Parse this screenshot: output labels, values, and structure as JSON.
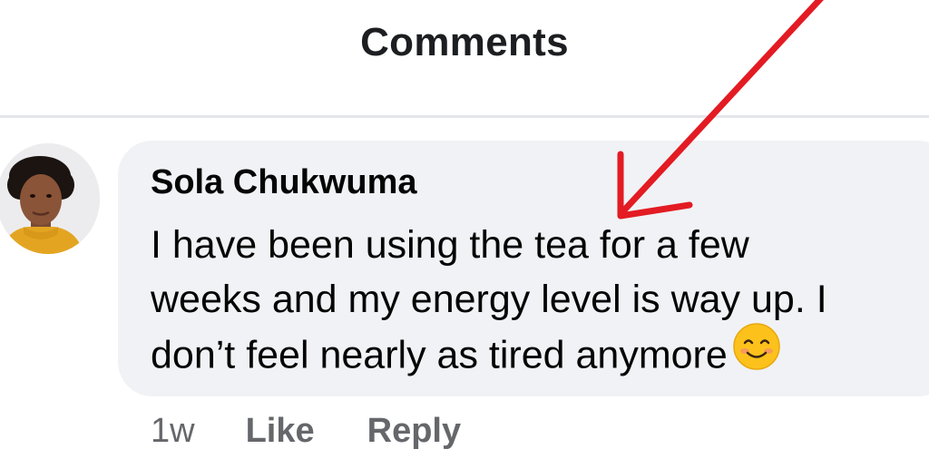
{
  "header": {
    "title": "Comments"
  },
  "comment": {
    "author": "Sola Chukwuma",
    "text_line_1": "I have been using the tea for a few",
    "text_line_2": "weeks and my energy level is way up. I",
    "text_line_3": "don’t feel nearly as tired anymore",
    "emoji": "smiling-face-icon",
    "timestamp": "1w",
    "like_label": "Like",
    "reply_label": "Reply"
  },
  "colors": {
    "bubble": "#f0f2f5",
    "text": "#050505",
    "secondary_text": "#65676b",
    "annotation_arrow": "#e31b23"
  }
}
